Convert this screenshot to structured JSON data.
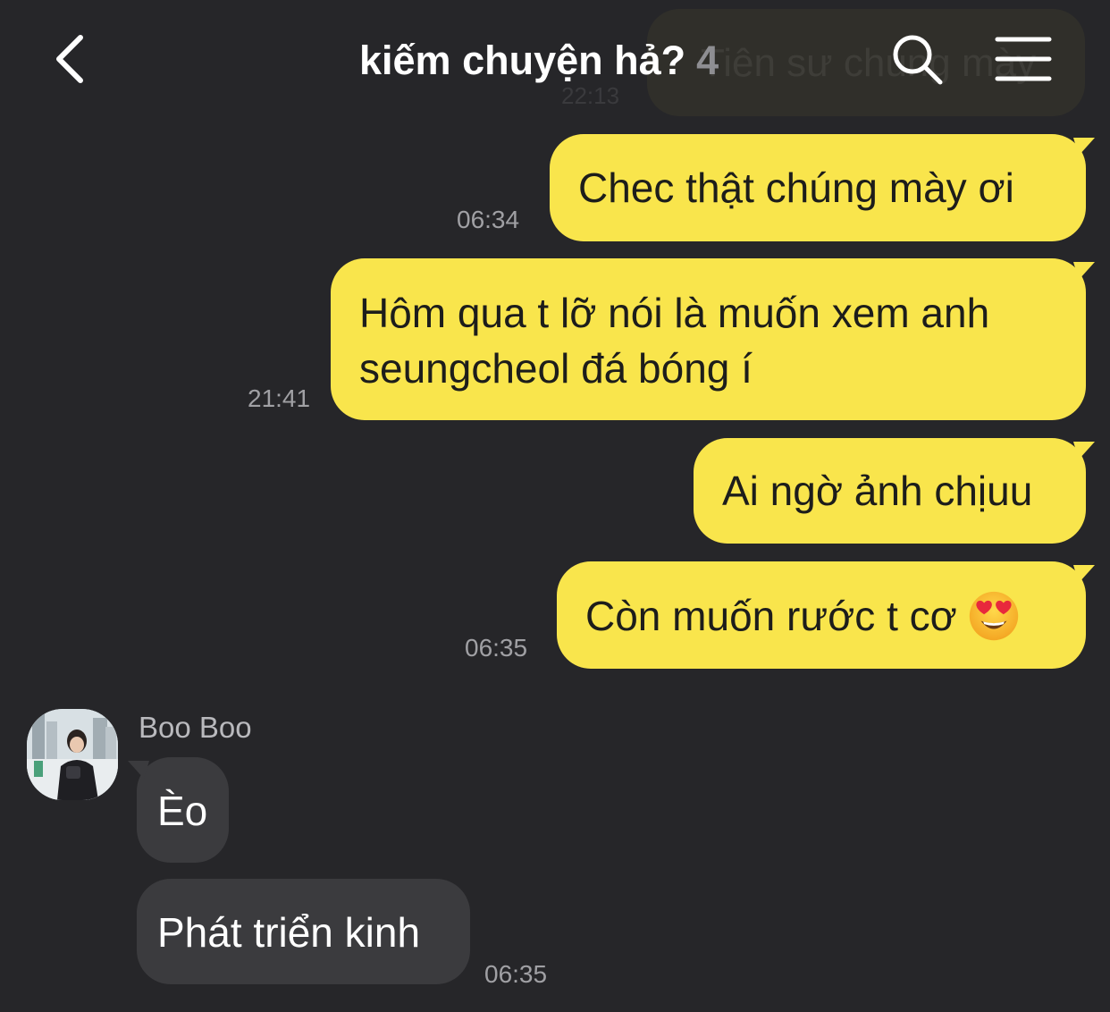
{
  "header": {
    "title": "kiếm chuyện hả?",
    "member_count": "4"
  },
  "ghost_message": {
    "text": "Tiên sư chúng mày",
    "time": "22:13"
  },
  "messages": [
    {
      "side": "me",
      "text": "Chec thật chúng mày ơi",
      "time": "06:34"
    },
    {
      "side": "me",
      "lines": [
        "Hôm qua t lỡ nói là muốn xem anh",
        "seungcheol đá bóng í"
      ],
      "time": "21:41"
    },
    {
      "side": "me",
      "text": "Ai ngờ ảnh chịuu",
      "time": ""
    },
    {
      "side": "me",
      "text": "Còn muốn rước t cơ",
      "emoji": "heart-eyes-emoji",
      "time": "06:35"
    },
    {
      "side": "them",
      "sender": "Boo Boo",
      "text": "Èo",
      "time": ""
    },
    {
      "side": "them",
      "text": "Phát triển kinh",
      "time": "06:35"
    }
  ],
  "colors": {
    "background": "#262629",
    "my_bubble": "#f9e54c",
    "their_bubble": "#3b3b3e",
    "timestamp": "#a0a0a4"
  },
  "icons": {
    "back": "chevron-left-icon",
    "search": "search-icon",
    "menu": "hamburger-menu-icon"
  }
}
